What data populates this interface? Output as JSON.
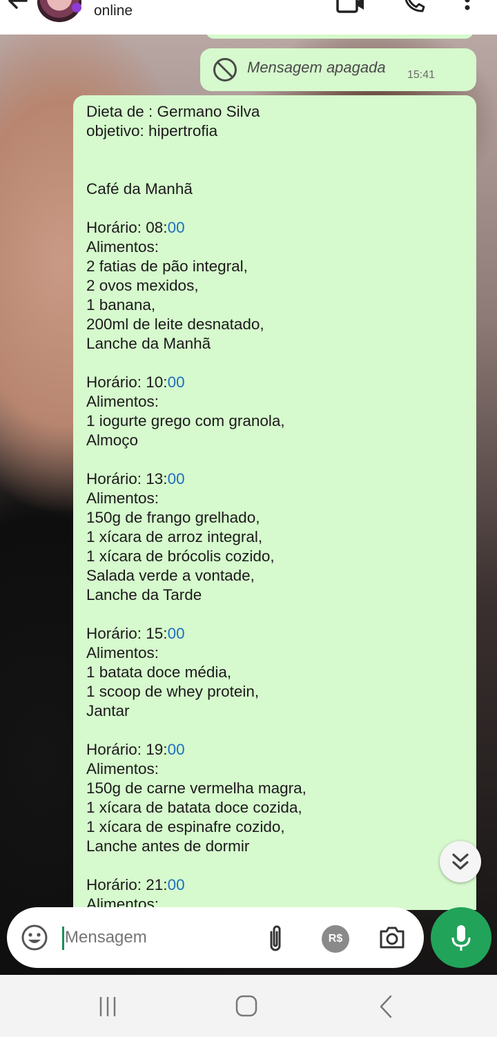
{
  "header": {
    "status": "online"
  },
  "deleted_message": {
    "text": "Mensagem apagada",
    "time": "15:41"
  },
  "message": {
    "lines": [
      {
        "text": "Dieta de : Germano Silva"
      },
      {
        "text": "objetivo: hipertrofia"
      },
      {
        "text": ""
      },
      {
        "text": ""
      },
      {
        "text": "Café da Manhã"
      },
      {
        "text": ""
      },
      {
        "text": "Horário: 08:",
        "link": "00"
      },
      {
        "text": "Alimentos:"
      },
      {
        "text": "2 fatias de pão integral,"
      },
      {
        "text": "2 ovos mexidos,"
      },
      {
        "text": "1 banana,"
      },
      {
        "text": "200ml de leite desnatado,"
      },
      {
        "text": "Lanche da Manhã"
      },
      {
        "text": ""
      },
      {
        "text": "Horário: 10:",
        "link": "00"
      },
      {
        "text": "Alimentos:"
      },
      {
        "text": "1 iogurte grego com granola,"
      },
      {
        "text": "Almoço"
      },
      {
        "text": ""
      },
      {
        "text": "Horário: 13:",
        "link": "00"
      },
      {
        "text": "Alimentos:"
      },
      {
        "text": "150g de frango grelhado,"
      },
      {
        "text": "1 xícara de arroz integral,"
      },
      {
        "text": "1 xícara de brócolis cozido,"
      },
      {
        "text": "Salada verde a vontade,"
      },
      {
        "text": "Lanche da Tarde"
      },
      {
        "text": ""
      },
      {
        "text": "Horário: 15:",
        "link": "00"
      },
      {
        "text": "Alimentos:"
      },
      {
        "text": "1 batata doce média,"
      },
      {
        "text": "1 scoop de whey protein,"
      },
      {
        "text": "Jantar"
      },
      {
        "text": ""
      },
      {
        "text": "Horário: 19:",
        "link": "00"
      },
      {
        "text": "Alimentos:"
      },
      {
        "text": "150g de carne vermelha magra,"
      },
      {
        "text": "1 xícara de batata doce cozida,"
      },
      {
        "text": "1 xícara de espinafre cozido,"
      },
      {
        "text": "Lanche antes de dormir"
      },
      {
        "text": ""
      },
      {
        "text": "Horário: 21:",
        "link": "00"
      },
      {
        "text": "Alimentos:"
      }
    ]
  },
  "input": {
    "placeholder": "Mensagem",
    "payment_label": "R$"
  },
  "icons": {
    "back": "back-arrow-icon",
    "video": "video-call-icon",
    "call": "phone-icon",
    "menu": "more-vertical-icon",
    "deleted": "blocked-icon",
    "scroll": "double-chevron-down-icon",
    "emoji": "emoji-icon",
    "attach": "paperclip-icon",
    "camera": "camera-icon",
    "mic": "mic-icon"
  },
  "colors": {
    "bubble": "#d6f9cd",
    "accent": "#22a35a",
    "link": "#1f6fbf"
  }
}
